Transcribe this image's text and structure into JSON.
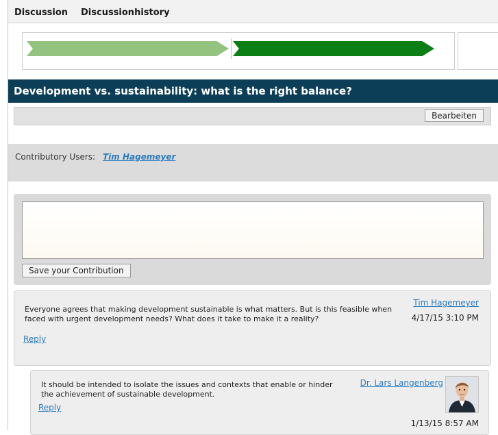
{
  "tabs": [
    "Discussion",
    "Discussionhistory"
  ],
  "progress": {
    "steps": 2,
    "completed_color": "#93c37f",
    "current_color": "#0b7f13"
  },
  "title": "Development vs. sustainability: what is the right balance?",
  "toolbar": {
    "edit_label": "Bearbeiten"
  },
  "contributors": {
    "label": "Contributory Users:",
    "user": "Tim Hagemeyer"
  },
  "compose": {
    "value": "",
    "save_label": "Save your Contribution"
  },
  "posts": [
    {
      "text": "Everyone agrees that making development sustainable is what matters. But is this feasible when faced with urgent development needs? What does it take to make it a reality?",
      "author": "Tim Hagemeyer",
      "timestamp": "4/17/15 3:10 PM",
      "reply_label": "Reply",
      "replies": [
        {
          "text": "It should be intended to isolate the issues and contexts that enable or hinder the achievement of sustainable development.",
          "author": "Dr. Lars Langenberg",
          "timestamp": "1/13/15 8:57 AM",
          "reply_label": "Reply",
          "avatar_icon": "person-photo"
        }
      ]
    }
  ],
  "colors": {
    "title_bar": "#0c3f57",
    "link": "#2a7bbf"
  }
}
